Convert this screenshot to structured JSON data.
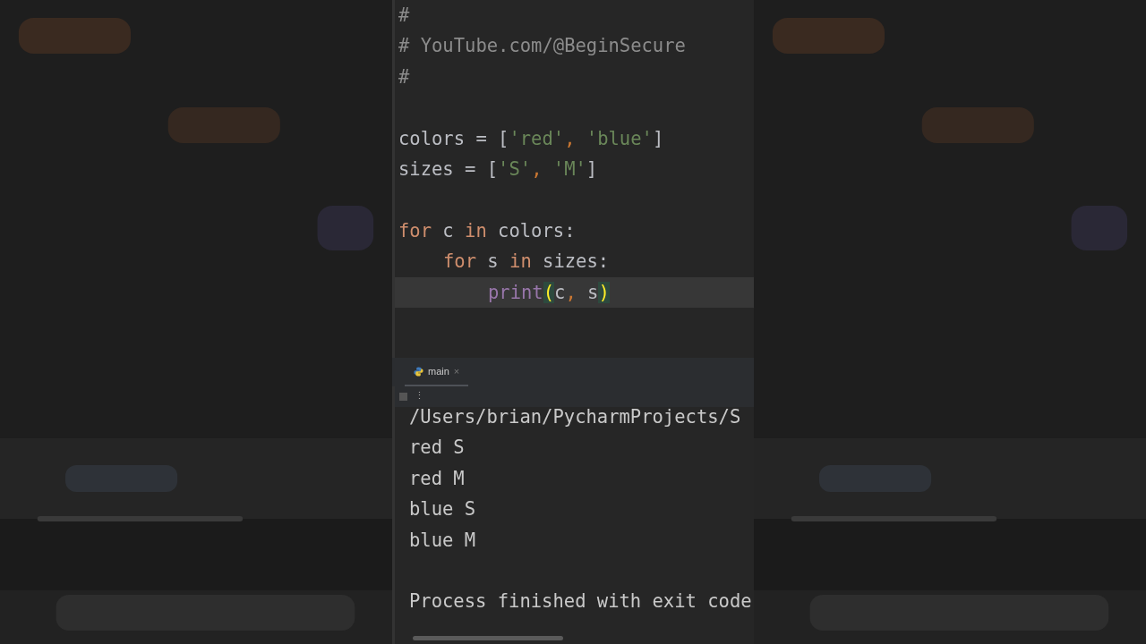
{
  "editor": {
    "lines": [
      {
        "current": false,
        "tokens": [
          {
            "kind": "comment",
            "text": "#"
          }
        ]
      },
      {
        "current": false,
        "tokens": [
          {
            "kind": "comment",
            "text": "# YouTube.com/@BeginSecure"
          }
        ]
      },
      {
        "current": false,
        "tokens": [
          {
            "kind": "comment",
            "text": "#"
          }
        ]
      },
      {
        "current": false
      },
      {
        "current": false,
        "tokens": [
          {
            "kind": "ident",
            "text": "colors = ["
          },
          {
            "kind": "string",
            "text": "'red'"
          },
          {
            "kind": "punct",
            "text": ", "
          },
          {
            "kind": "string",
            "text": "'blue'"
          },
          {
            "kind": "ident",
            "text": "]"
          }
        ]
      },
      {
        "current": false,
        "tokens": [
          {
            "kind": "ident",
            "text": "sizes = ["
          },
          {
            "kind": "string",
            "text": "'S'"
          },
          {
            "kind": "punct",
            "text": ", "
          },
          {
            "kind": "string",
            "text": "'M'"
          },
          {
            "kind": "ident",
            "text": "]"
          }
        ]
      },
      {
        "current": false
      },
      {
        "current": false,
        "tokens": [
          {
            "kind": "keyword",
            "text": "for"
          },
          {
            "kind": "ident",
            "text": " c "
          },
          {
            "kind": "keyword",
            "text": "in"
          },
          {
            "kind": "ident",
            "text": " colors:"
          }
        ],
        "children": [
          {
            "current": false,
            "tokens": [
              {
                "kind": "keyword",
                "text": "for"
              },
              {
                "kind": "ident",
                "text": " s "
              },
              {
                "kind": "keyword",
                "text": "in"
              },
              {
                "kind": "ident",
                "text": " sizes:"
              }
            ],
            "children": [
              {
                "current": true,
                "tokens": [
                  {
                    "kind": "builtin",
                    "text": "print"
                  },
                  {
                    "kind": "brace",
                    "text": "("
                  },
                  {
                    "kind": "ident",
                    "text": "c"
                  },
                  {
                    "kind": "punct",
                    "text": ", "
                  },
                  {
                    "kind": "ident",
                    "text": "s"
                  },
                  {
                    "kind": "brace",
                    "text": ")"
                  }
                ]
              }
            ]
          }
        ]
      }
    ]
  },
  "run_panel": {
    "tabs": [
      {
        "label": "main",
        "selected": true,
        "close": "×"
      }
    ],
    "toolbar": [
      "⋮"
    ],
    "output": [
      "/Users/brian/PycharmProjects/S",
      "red S",
      "red M",
      "blue S",
      "blue M"
    ],
    "exit_message": "Process finished with exit code"
  }
}
